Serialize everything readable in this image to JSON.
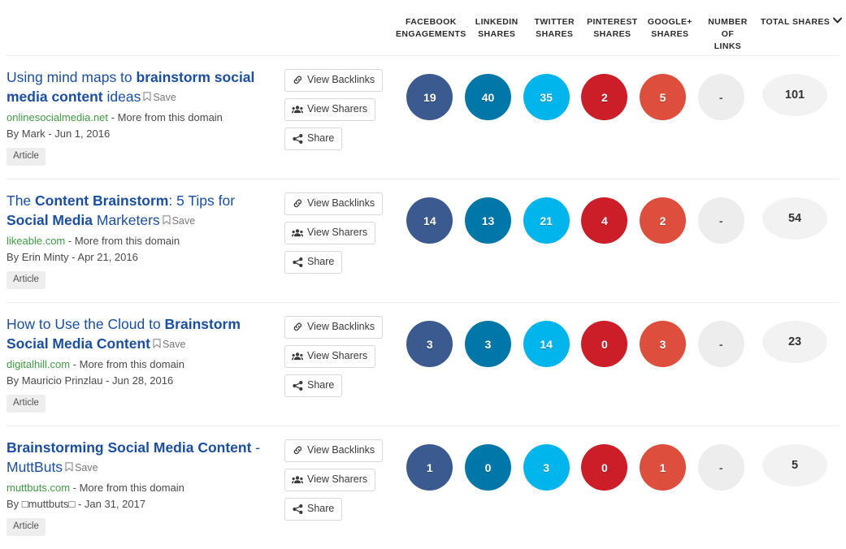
{
  "columns": {
    "facebook": "FACEBOOK\nENGAGEMENTS",
    "linkedin": "LINKEDIN\nSHARES",
    "twitter": "TWITTER\nSHARES",
    "pinterest": "PINTEREST\nSHARES",
    "googleplus": "GOOGLE+\nSHARES",
    "links": "NUMBER OF\nLINKS",
    "total": "TOTAL SHARES"
  },
  "actions": {
    "view_backlinks": "View Backlinks",
    "view_sharers": "View Sharers",
    "share": "Share"
  },
  "common": {
    "save": "Save",
    "more_from_domain": "More from this domain",
    "separator": " - ",
    "by_prefix": "By ",
    "tag": "Article"
  },
  "colors": {
    "facebook": "#3b5a8f",
    "linkedin": "#0077a8",
    "twitter": "#00b5ec",
    "pinterest": "#cb1e28",
    "googleplus": "#dd4f3c",
    "empty": "#ededed",
    "total": "#f2f2f2",
    "title_link": "#1a4fa0",
    "domain_link": "#3e9b43"
  },
  "results": [
    {
      "title_parts": [
        {
          "text": "Using mind maps to ",
          "bold": false
        },
        {
          "text": "brainstorm social media content",
          "bold": true
        },
        {
          "text": " ideas",
          "bold": false
        }
      ],
      "domain": "onlinesocialmedia.net",
      "author": "Mark",
      "date": "Jun 1, 2016",
      "byline": "By Mark - Jun 1, 2016",
      "tag": "Article",
      "metrics": {
        "facebook": "19",
        "linkedin": "40",
        "twitter": "35",
        "pinterest": "2",
        "googleplus": "5",
        "links": "-",
        "total": "101"
      }
    },
    {
      "title_parts": [
        {
          "text": "The ",
          "bold": false
        },
        {
          "text": "Content Brainstorm",
          "bold": true
        },
        {
          "text": ": 5 Tips for ",
          "bold": false
        },
        {
          "text": "Social Media",
          "bold": true
        },
        {
          "text": " Marketers",
          "bold": false
        }
      ],
      "domain": "likeable.com",
      "author": "Erin Minty",
      "date": "Apr 21, 2016",
      "byline": "By Erin Minty - Apr 21, 2016",
      "tag": "Article",
      "metrics": {
        "facebook": "14",
        "linkedin": "13",
        "twitter": "21",
        "pinterest": "4",
        "googleplus": "2",
        "links": "-",
        "total": "54"
      }
    },
    {
      "title_parts": [
        {
          "text": "How to Use the Cloud to ",
          "bold": false
        },
        {
          "text": "Brainstorm Social Media Content",
          "bold": true
        }
      ],
      "domain": "digitalhill.com",
      "author": "Mauricio Prinzlau",
      "date": "Jun 28, 2016",
      "byline": "By Mauricio Prinzlau - Jun 28, 2016",
      "tag": "Article",
      "metrics": {
        "facebook": "3",
        "linkedin": "3",
        "twitter": "14",
        "pinterest": "0",
        "googleplus": "3",
        "links": "-",
        "total": "23"
      }
    },
    {
      "title_parts": [
        {
          "text": "Brainstorming Social Media Content",
          "bold": true
        },
        {
          "text": " - MuttButs",
          "bold": false
        }
      ],
      "domain": "muttbuts.com",
      "author": "□muttbuts□",
      "date": "Jan 31, 2017",
      "byline": "By □muttbuts□ - Jan 31, 2017",
      "tag": "Article",
      "metrics": {
        "facebook": "1",
        "linkedin": "0",
        "twitter": "3",
        "pinterest": "0",
        "googleplus": "1",
        "links": "-",
        "total": "5"
      }
    }
  ]
}
